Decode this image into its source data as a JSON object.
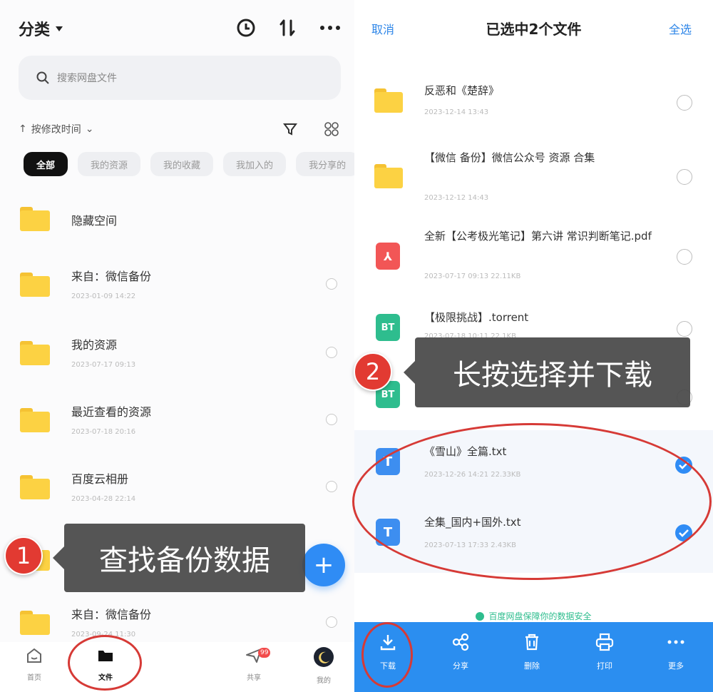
{
  "left": {
    "header": {
      "title": "分类"
    },
    "search": {
      "placeholder": "搜索网盘文件"
    },
    "sort": {
      "label": "按修改时间"
    },
    "chips": [
      "全部",
      "我的资源",
      "我的收藏",
      "我加入的",
      "我分享的"
    ],
    "items": [
      {
        "name": "隐藏空间",
        "date": ""
      },
      {
        "name": "来自：微信备份",
        "date": "2023-01-09  14:22"
      },
      {
        "name": "我的资源",
        "date": "2023-07-17  09:13"
      },
      {
        "name": "最近查看的资源",
        "date": "2023-07-18  20:16"
      },
      {
        "name": "百度云相册",
        "date": "2023-04-28  22:14"
      },
      {
        "name": "来自：微信备份",
        "date": "2023-09-24  11:30"
      }
    ],
    "nav": [
      {
        "label": "首页",
        "icon": "home-icon"
      },
      {
        "label": "文件",
        "icon": "folder-icon"
      },
      {
        "label": "共享",
        "icon": "send-icon",
        "badge": "99"
      },
      {
        "label": "我的",
        "icon": "moon-avatar-icon"
      }
    ],
    "callout": {
      "text": "查找备份数据",
      "step": "1"
    }
  },
  "right": {
    "header": {
      "cancel": "取消",
      "title": "已选中2个文件",
      "select_all": "全选"
    },
    "items": [
      {
        "type": "folder",
        "name": "反恶和《楚辞》",
        "date": "2023-12-14  13:43",
        "checked": false
      },
      {
        "type": "folder",
        "name": "【微信 备份】微信公众号 资源 合集",
        "date": "2023-12-12  14:43",
        "checked": false
      },
      {
        "type": "pdf",
        "name": "全新【公考极光笔记】第六讲 常识判断笔记.pdf",
        "date": "2023-07-17  09:13  22.11KB",
        "checked": false
      },
      {
        "type": "bt",
        "name": "【极限挑战】.torrent",
        "date": "2023-07-18  10:11  22.1KB",
        "checked": false
      },
      {
        "type": "bt",
        "name": "",
        "date": "",
        "checked": false
      },
      {
        "type": "txt",
        "name": "《雪山》全篇.txt",
        "date": "2023-12-26  14:21  22.33KB",
        "checked": true
      },
      {
        "type": "txt",
        "name": "全集_国内+国外.txt",
        "date": "2023-07-13  17:33  2.43KB",
        "checked": true
      }
    ],
    "hint": "百度网盘保障你的数据安全",
    "toolbar": [
      {
        "label": "下载",
        "icon": "download-icon"
      },
      {
        "label": "分享",
        "icon": "share-icon"
      },
      {
        "label": "删除",
        "icon": "delete-icon"
      },
      {
        "label": "打印",
        "icon": "print-icon"
      },
      {
        "label": "更多",
        "icon": "more-icon"
      }
    ],
    "callout": {
      "text": "长按选择并下载",
      "step": "2"
    }
  }
}
